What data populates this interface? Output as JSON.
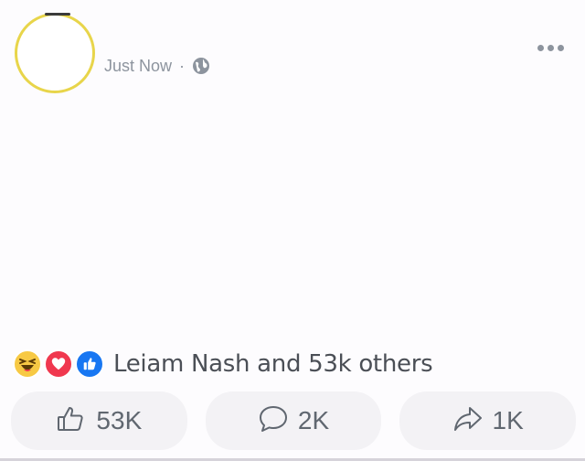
{
  "post": {
    "timestamp": "Just Now",
    "separator": "·",
    "privacy_icon": "globe-icon",
    "more_icon": "more-options-icon"
  },
  "reactions": {
    "icons": [
      "haha-reaction-icon",
      "love-reaction-icon",
      "like-reaction-icon"
    ],
    "summary": "Leiam Nash and 53k others"
  },
  "actions": {
    "like": {
      "icon": "thumbs-up-icon",
      "count": "53K"
    },
    "comment": {
      "icon": "comment-bubble-icon",
      "count": "2K"
    },
    "share": {
      "icon": "share-arrow-icon",
      "count": "1K"
    }
  },
  "colors": {
    "avatar_ring": "#e8d54a",
    "like_blue": "#1877f2",
    "love_red": "#f0384f",
    "haha_yellow": "#f7c944",
    "button_bg": "#f3f2f5",
    "muted_text": "#8d949e"
  }
}
